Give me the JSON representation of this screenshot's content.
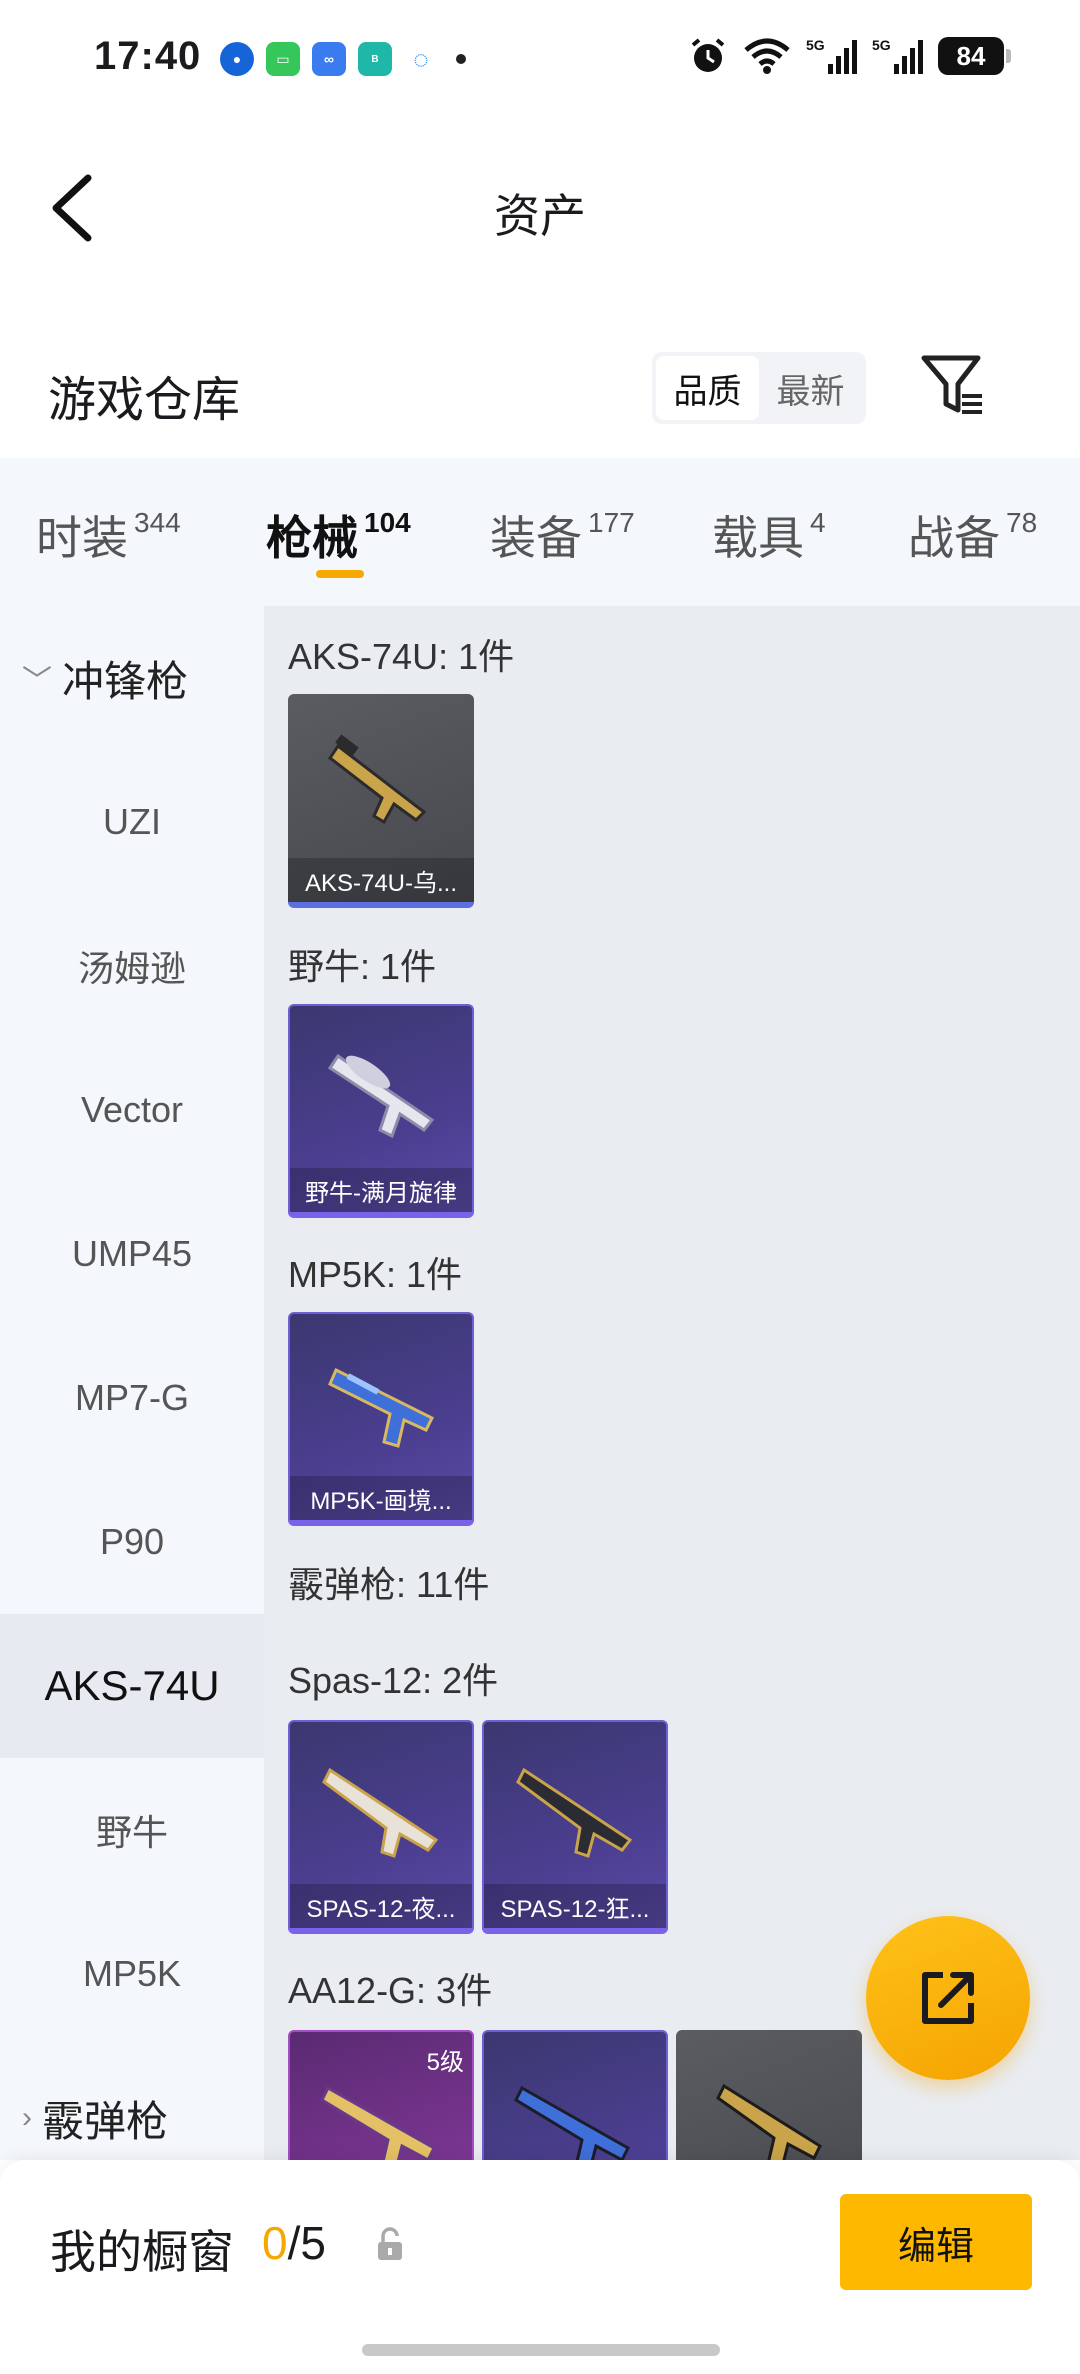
{
  "status_bar": {
    "time": "17:40",
    "battery": "84"
  },
  "header": {
    "title": "资产"
  },
  "warehouse": {
    "title": "游戏仓库",
    "sort_options": [
      "品质",
      "最新"
    ]
  },
  "tabs": [
    {
      "label": "时装",
      "count": "344"
    },
    {
      "label": "枪械",
      "count": "104"
    },
    {
      "label": "装备",
      "count": "177"
    },
    {
      "label": "载具",
      "count": "4"
    },
    {
      "label": "战备",
      "count": "78"
    }
  ],
  "sidebar": {
    "group1": "冲锋枪",
    "items": [
      "UZI",
      "汤姆逊",
      "Vector",
      "UMP45",
      "MP7-G",
      "P90",
      "AKS-74U",
      "野牛",
      "MP5K"
    ],
    "group2": "霰弹枪"
  },
  "sections": [
    {
      "label": "AKS-74U: 1件",
      "cards": [
        {
          "name": "AKS-74U-乌..."
        }
      ]
    },
    {
      "label": "野牛: 1件",
      "cards": [
        {
          "name": "野牛-满月旋律"
        }
      ]
    },
    {
      "label": "MP5K: 1件",
      "cards": [
        {
          "name": "MP5K-画境..."
        }
      ]
    },
    {
      "label": "霰弹枪: 11件"
    },
    {
      "label": "Spas-12: 2件",
      "cards": [
        {
          "name": "SPAS-12-夜..."
        },
        {
          "name": "SPAS-12-狂..."
        }
      ]
    },
    {
      "label": "AA12-G: 3件",
      "cards": [
        {
          "level": "5级"
        }
      ]
    }
  ],
  "bottom": {
    "label": "我的橱窗",
    "current": "0",
    "total": "/5",
    "edit": "编辑"
  },
  "colors": {
    "accent": "#ffb800",
    "tab_underline": "#f7a800"
  }
}
